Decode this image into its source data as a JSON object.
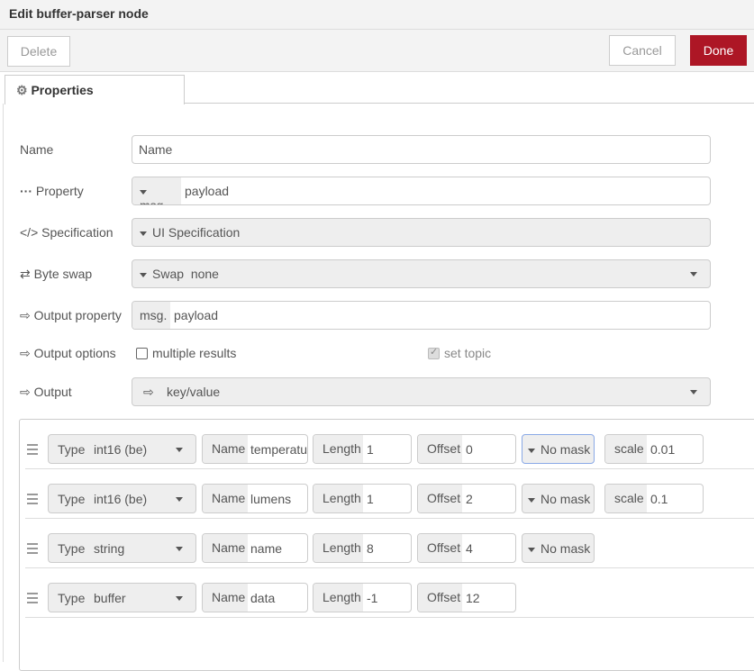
{
  "title": "Edit buffer-parser node",
  "toolbar": {
    "delete": "Delete",
    "cancel": "Cancel",
    "done": "Done",
    "done_color": "#ad1625"
  },
  "tab": {
    "label": "Properties",
    "icon": "gear-icon"
  },
  "form": {
    "name": {
      "label": "Name",
      "placeholder": "Name",
      "value": ""
    },
    "property": {
      "label": "Property",
      "prefix": "msg.",
      "value": "payload"
    },
    "specification": {
      "label": "Specification",
      "value": "UI Specification"
    },
    "byteswap": {
      "label": "Byte swap",
      "prefix": "Swap",
      "value": "none"
    },
    "output_property": {
      "label": "Output property",
      "prefix": "msg.",
      "value": "payload"
    },
    "output_options": {
      "label": "Output options",
      "multiple": "multiple results",
      "multiple_checked": false,
      "set_topic": "set topic",
      "set_topic_checked": true
    },
    "output": {
      "label": "Output",
      "value": "key/value"
    }
  },
  "fields": [
    {
      "type_label": "Type",
      "type": "int16 (be)",
      "name_label": "Name",
      "name": "temperatu",
      "length_label": "Length",
      "length": "1",
      "offset_label": "Offset",
      "offset": "0",
      "mask": "No mask",
      "scale_label": "scale",
      "scale": "0.01"
    },
    {
      "type_label": "Type",
      "type": "int16 (be)",
      "name_label": "Name",
      "name": "lumens",
      "length_label": "Length",
      "length": "1",
      "offset_label": "Offset",
      "offset": "2",
      "mask": "No mask",
      "scale_label": "scale",
      "scale": "0.1"
    },
    {
      "type_label": "Type",
      "type": "string",
      "name_label": "Name",
      "name": "name",
      "length_label": "Length",
      "length": "8",
      "offset_label": "Offset",
      "offset": "4",
      "mask": "No mask"
    },
    {
      "type_label": "Type",
      "type": "buffer",
      "name_label": "Name",
      "name": "data",
      "length_label": "Length",
      "length": "-1",
      "offset_label": "Offset",
      "offset": "12"
    }
  ]
}
